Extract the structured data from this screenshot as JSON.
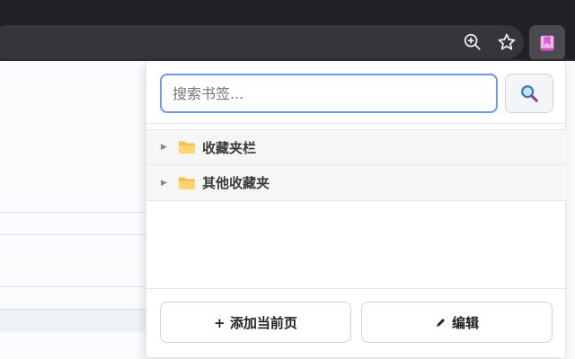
{
  "browser": {
    "zoom_icon": "zoom-in-icon",
    "bookmark_star_icon": "star-icon",
    "extension_icon": "bookmark-extension-icon"
  },
  "popup": {
    "search": {
      "placeholder": "搜索书签...",
      "value": "",
      "button_icon": "magnifier-icon"
    },
    "folders": [
      {
        "label": "收藏夹栏",
        "icon": "folder-icon"
      },
      {
        "label": "其他收藏夹",
        "icon": "folder-icon"
      }
    ],
    "footer": {
      "add_label": "+ 添加当前页",
      "edit_icon": "pencil-icon",
      "edit_label": "编辑"
    }
  },
  "colors": {
    "chrome_dark": "#202124",
    "input_focus": "#6b96f3",
    "folder": "#f6c04f",
    "extension_accent": "#e05ad2"
  }
}
